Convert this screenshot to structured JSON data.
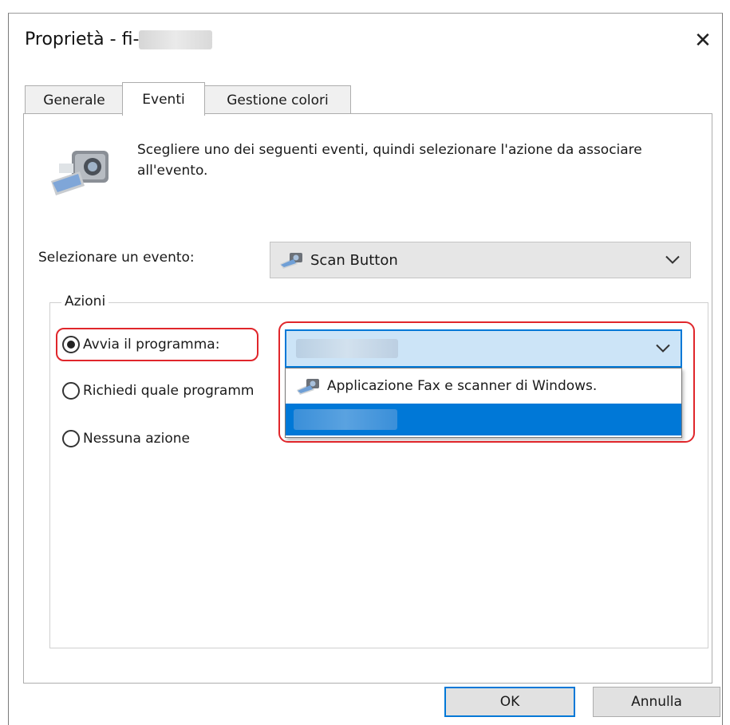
{
  "window": {
    "title": "Proprietà - fi-",
    "close_glyph": "✕"
  },
  "tabs": [
    {
      "label": "Generale"
    },
    {
      "label": "Eventi"
    },
    {
      "label": "Gestione colori"
    }
  ],
  "events_tab": {
    "description": "Scegliere uno dei seguenti eventi, quindi selezionare l'azione da associare all'evento.",
    "event_label": "Selezionare un evento:",
    "event_selected": "Scan Button"
  },
  "actions": {
    "legend": "Azioni",
    "start_program": "Avvia il programma:",
    "prompt_program": "Richiedi quale programm",
    "no_action": "Nessuna azione",
    "selected_option": "start_program"
  },
  "program_dropdown": {
    "options": [
      {
        "label": "Applicazione Fax e scanner di Windows."
      }
    ]
  },
  "buttons": {
    "ok": "OK",
    "cancel": "Annulla"
  },
  "colors": {
    "accent": "#0078d7",
    "highlight_red": "#e0262b",
    "select_bg": "#cce4f7"
  },
  "icons": {
    "event_icon": "scanner-icon",
    "option_icon": "scanner-icon",
    "chevron": "chevron-down-icon",
    "close": "close-icon"
  }
}
